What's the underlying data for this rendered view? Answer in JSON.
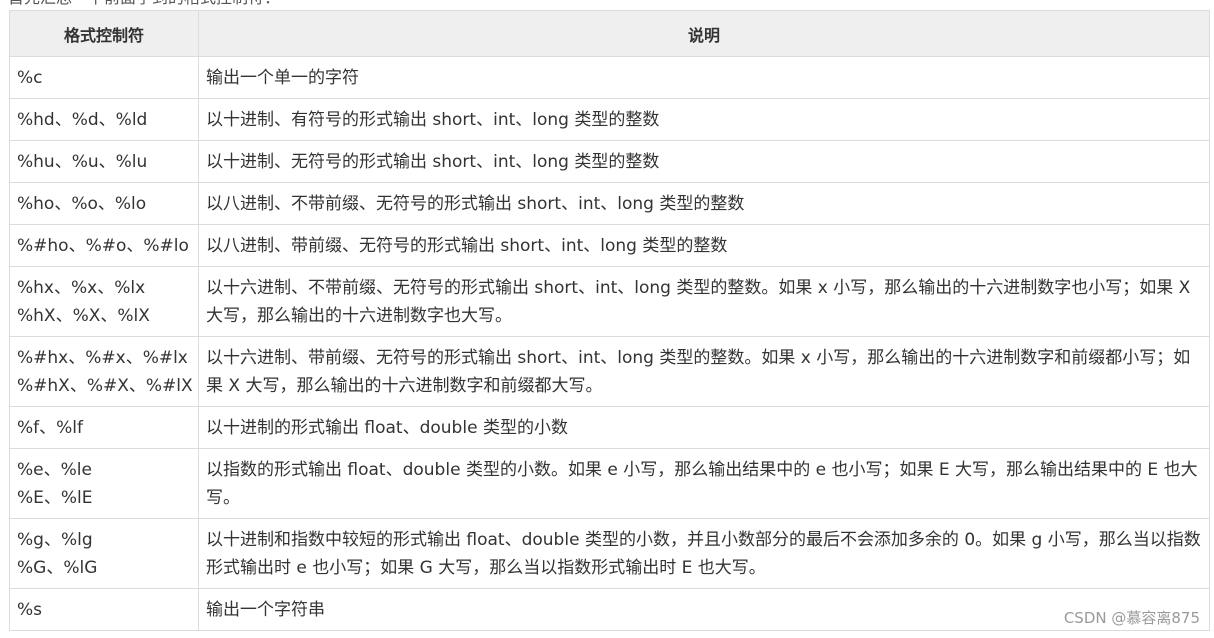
{
  "top_caption": "首先汇总一下前面学到的格式控制符：",
  "table": {
    "headers": {
      "format": "格式控制符",
      "description": "说明"
    },
    "rows": [
      {
        "format": [
          "%c"
        ],
        "description": "输出一个单一的字符"
      },
      {
        "format": [
          "%hd、%d、%ld"
        ],
        "description": "以十进制、有符号的形式输出 short、int、long 类型的整数"
      },
      {
        "format": [
          "%hu、%u、%lu"
        ],
        "description": "以十进制、无符号的形式输出 short、int、long 类型的整数"
      },
      {
        "format": [
          "%ho、%o、%lo"
        ],
        "description": "以八进制、不带前缀、无符号的形式输出 short、int、long 类型的整数"
      },
      {
        "format": [
          "%#ho、%#o、%#lo"
        ],
        "description": "以八进制、带前缀、无符号的形式输出 short、int、long 类型的整数"
      },
      {
        "format": [
          "%hx、%x、%lx",
          "%hX、%X、%lX"
        ],
        "description": "以十六进制、不带前缀、无符号的形式输出 short、int、long 类型的整数。如果 x 小写，那么输出的十六进制数字也小写；如果 X 大写，那么输出的十六进制数字也大写。"
      },
      {
        "format": [
          "%#hx、%#x、%#lx",
          "%#hX、%#X、%#lX"
        ],
        "description": "以十六进制、带前缀、无符号的形式输出 short、int、long 类型的整数。如果 x 小写，那么输出的十六进制数字和前缀都小写；如果 X 大写，那么输出的十六进制数字和前缀都大写。"
      },
      {
        "format": [
          "%f、%lf"
        ],
        "description": "以十进制的形式输出 float、double 类型的小数"
      },
      {
        "format": [
          "%e、%le",
          "%E、%lE"
        ],
        "description": "以指数的形式输出 float、double 类型的小数。如果 e 小写，那么输出结果中的 e 也小写；如果 E 大写，那么输出结果中的 E 也大写。"
      },
      {
        "format": [
          "%g、%lg",
          "%G、%lG"
        ],
        "description": "以十进制和指数中较短的形式输出 float、double 类型的小数，并且小数部分的最后不会添加多余的 0。如果 g 小写，那么当以指数形式输出时 e 也小写；如果 G 大写，那么当以指数形式输出时 E 也大写。"
      },
      {
        "format": [
          "%s"
        ],
        "description": "输出一个字符串"
      }
    ]
  },
  "watermark": "CSDN @慕容离875"
}
